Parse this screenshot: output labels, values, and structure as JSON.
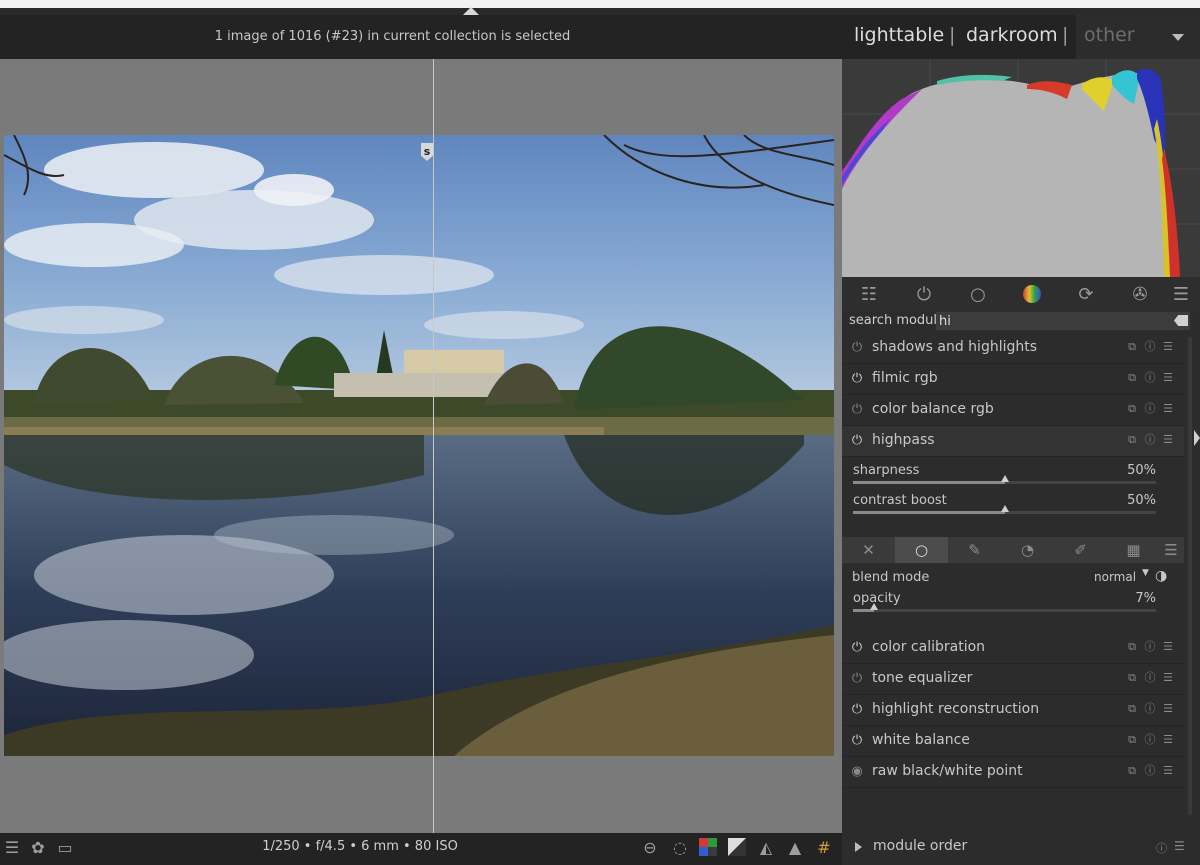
{
  "header": {
    "info": "1 image of 1016 (#23) in current collection is selected"
  },
  "views": {
    "lighttable": "lighttable",
    "separator": "|",
    "darkroom": "darkroom",
    "other": "other"
  },
  "center": {
    "split_marker": "s"
  },
  "footer": {
    "exif": "1/250 • f/4.5 • 6 mm • 80 ISO"
  },
  "search": {
    "label": "search module",
    "value": "hi"
  },
  "modules": [
    {
      "name": "shadows and highlights",
      "enabled": false
    },
    {
      "name": "filmic rgb",
      "enabled": true
    },
    {
      "name": "color balance rgb",
      "enabled": false
    },
    {
      "name": "highpass",
      "enabled": true,
      "expanded": true
    }
  ],
  "highpass": {
    "sharpness": {
      "label": "sharpness",
      "value": "50%",
      "level": 0.5
    },
    "contrast": {
      "label": "contrast boost",
      "value": "50%",
      "level": 0.5
    }
  },
  "blend": {
    "mode_label": "blend mode",
    "mode_value": "normal",
    "opacity_label": "opacity",
    "opacity_value": "7%",
    "opacity_level": 0.07
  },
  "modules_after": [
    {
      "name": "color calibration",
      "enabled": true
    },
    {
      "name": "tone equalizer",
      "enabled": false
    },
    {
      "name": "highlight reconstruction",
      "enabled": true
    },
    {
      "name": "white balance",
      "enabled": true
    },
    {
      "name": "raw black/white point",
      "enabled": true
    }
  ],
  "module_order": {
    "label": "module order"
  },
  "colors": {
    "panel": "#2c2c2c",
    "header": "#232323",
    "canvas": "#7a7a7a",
    "text": "#c8c8c8"
  },
  "icons": {
    "tabs": [
      "quick-access-icon",
      "power-icon",
      "circle-icon",
      "color-wheel-icon",
      "loop-icon",
      "aperture-icon",
      "menu-icon"
    ],
    "blend_tabs": [
      "off-icon",
      "uniform-icon",
      "drawn-mask-icon",
      "parametric-mask-icon",
      "drawn-parametric-icon",
      "raster-mask-icon",
      "menu-icon"
    ],
    "footer_left": [
      "menu-icon",
      "styles-icon",
      "display-icon"
    ],
    "footer_right": [
      "focus-peaking-icon",
      "bulb-icon",
      "color-assessment-icon",
      "raw-overexposed-icon",
      "softproof-icon",
      "gamut-check-icon",
      "guides-icon"
    ]
  }
}
